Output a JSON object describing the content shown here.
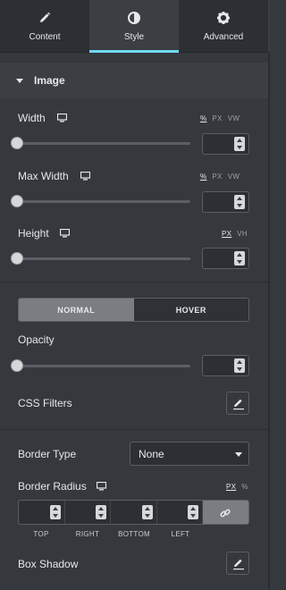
{
  "tabs": [
    {
      "label": "Content",
      "icon": "pencil-icon"
    },
    {
      "label": "Style",
      "icon": "half-circle-icon"
    },
    {
      "label": "Advanced",
      "icon": "gear-icon"
    }
  ],
  "section": {
    "title": "Image"
  },
  "controls": {
    "width": {
      "label": "Width",
      "units": [
        "%",
        "PX",
        "VW"
      ],
      "selected_unit": "%",
      "value": ""
    },
    "max_width": {
      "label": "Max Width",
      "units": [
        "%",
        "PX",
        "VW"
      ],
      "selected_unit": "%",
      "value": ""
    },
    "height": {
      "label": "Height",
      "units": [
        "PX",
        "VH"
      ],
      "selected_unit": "PX",
      "value": ""
    }
  },
  "state_toggle": {
    "normal": "NORMAL",
    "hover": "HOVER"
  },
  "opacity": {
    "label": "Opacity",
    "value": ""
  },
  "css_filters": {
    "label": "CSS Filters"
  },
  "border_type": {
    "label": "Border Type",
    "value": "None"
  },
  "border_radius": {
    "label": "Border Radius",
    "units": [
      "PX",
      "%"
    ],
    "selected_unit": "PX",
    "sides": [
      "TOP",
      "RIGHT",
      "BOTTOM",
      "LEFT"
    ]
  },
  "box_shadow": {
    "label": "Box Shadow"
  },
  "colors": {
    "accent": "#71d7f7",
    "panel": "#35383d",
    "tabs": "#2c2f33"
  }
}
